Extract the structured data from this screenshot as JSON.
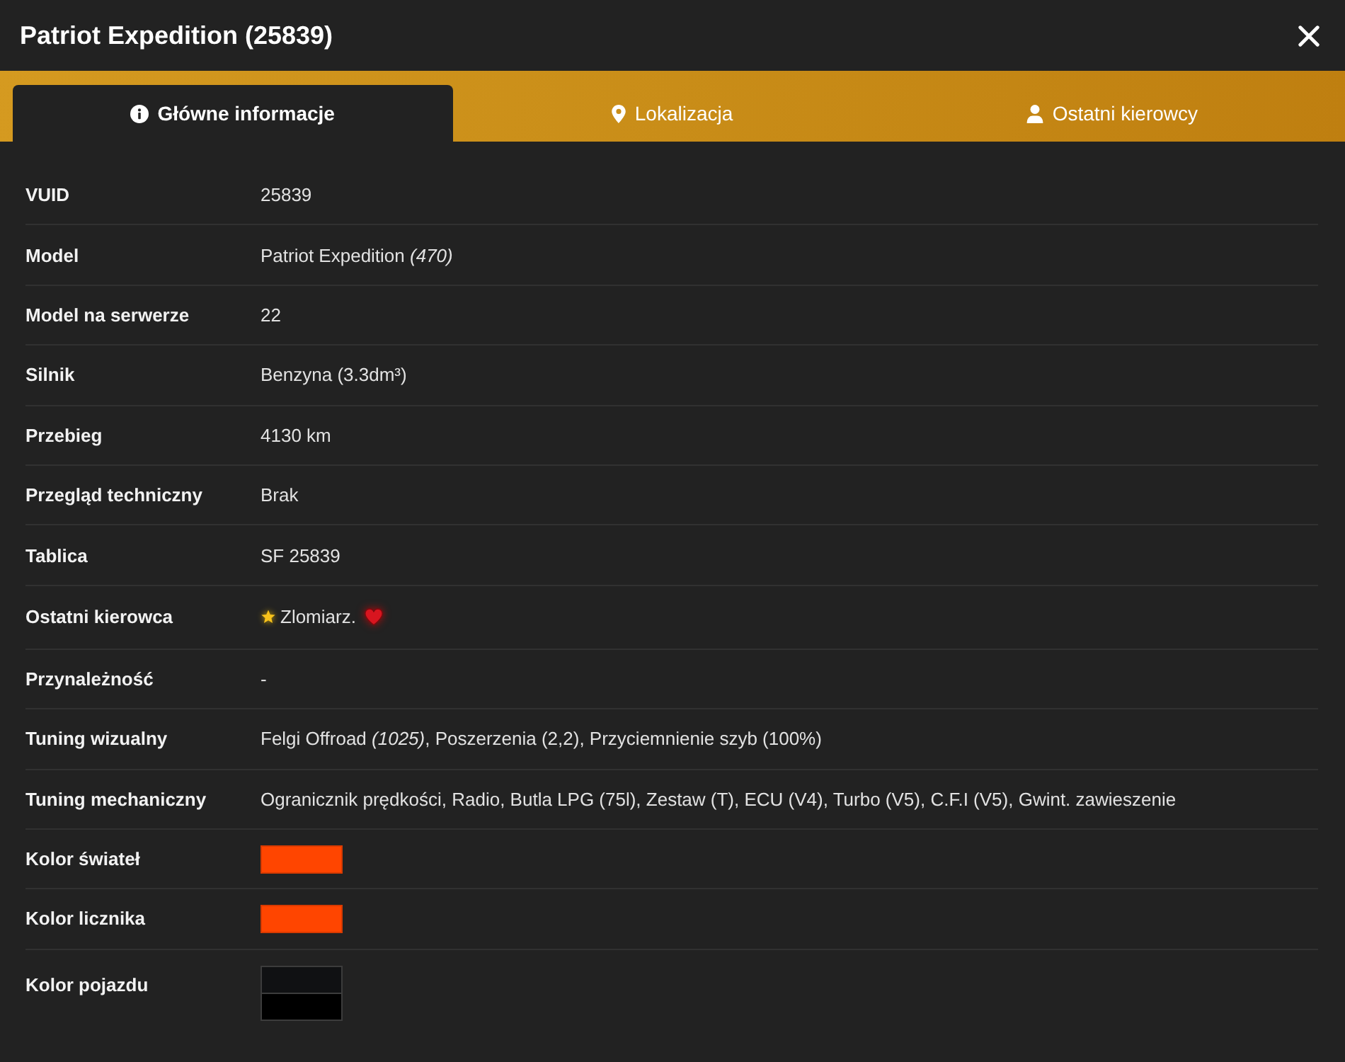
{
  "window": {
    "title": "Patriot Expedition (25839)"
  },
  "tabs": [
    {
      "label": "Główne informacje",
      "selected": true
    },
    {
      "label": "Lokalizacja",
      "selected": false
    },
    {
      "label": "Ostatni kierowcy",
      "selected": false
    }
  ],
  "rows": [
    {
      "kind": "text",
      "label": "VUID",
      "value": "25839"
    },
    {
      "kind": "text",
      "label": "Model",
      "value": "Patriot Expedition *(470)*"
    },
    {
      "kind": "text",
      "label": "Model na serwerze",
      "value": "22"
    },
    {
      "kind": "text",
      "label": "Silnik",
      "value": "Benzyna (3.3dm³)"
    },
    {
      "kind": "text",
      "label": "Przebieg",
      "value": "4130 km"
    },
    {
      "kind": "text",
      "label": "Przegląd techniczny",
      "value": "Brak"
    },
    {
      "kind": "text",
      "label": "Tablica",
      "value": "SF 25839"
    },
    {
      "kind": "driver",
      "label": "Ostatni kierowca",
      "value": "Zlomiarz."
    },
    {
      "kind": "text",
      "label": "Przynależność",
      "value": "-"
    },
    {
      "kind": "text",
      "label": "Tuning wizualny",
      "value": "Felgi Offroad *(1025)*, Poszerzenia (2,2), Przyciemnienie szyb (100%)"
    },
    {
      "kind": "text",
      "label": "Tuning mechaniczny",
      "value": "Ogranicznik prędkości, Radio, Butla LPG (75l), Zestaw (T), ECU (V4), Turbo (V5), C.F.I (V5), Gwint. zawieszenie"
    },
    {
      "kind": "swatch",
      "label": "Kolor świateł",
      "swatches": [
        {
          "color": "#ff4500"
        }
      ]
    },
    {
      "kind": "swatch",
      "label": "Kolor licznika",
      "swatches": [
        {
          "color": "#ff4500"
        }
      ]
    },
    {
      "kind": "swatch_pair",
      "label": "Kolor pojazdu",
      "swatches": [
        {
          "color": "#101113"
        },
        {
          "color": "#000000"
        }
      ]
    }
  ]
}
